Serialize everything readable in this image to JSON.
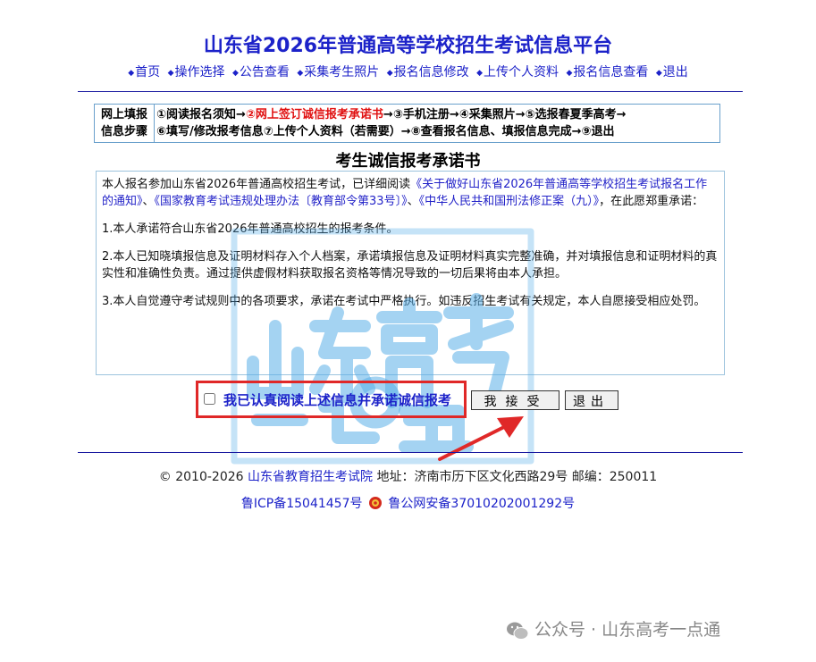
{
  "header": {
    "title": "山东省2026年普通高等学校招生考试信息平台",
    "nav": [
      "首页",
      "操作选择",
      "公告查看",
      "采集考生照片",
      "报名信息修改",
      "上传个人资料",
      "报名信息查看",
      "退出"
    ]
  },
  "steps": {
    "label_line1": "网上填报",
    "label_line2": "信息步骤",
    "line1_pre": "①阅读报名须知→",
    "line1_current": "②网上签订诚信报考承诺书",
    "line1_post": "→③手机注册→④采集照片→⑤选报春夏季高考→",
    "line2": "⑥填写/修改报考信息⑦上传个人资料（若需要）→⑧查看报名信息、填报信息完成→⑨退出"
  },
  "contract": {
    "heading": "考生诚信报考承诺书",
    "intro_pre": "本人报名参加山东省2026年普通高校招生考试，已详细阅读",
    "intro_link1": "《关于做好山东省2026年普通高等学校招生考试报名工作的通知》",
    "intro_sep1": "、",
    "intro_link2": "《国家教育考试违规处理办法〔教育部令第33号〕》",
    "intro_sep2": "、",
    "intro_link3": "《中华人民共和国刑法修正案（九）》",
    "intro_post": "，在此愿郑重承诺：",
    "items": [
      "1.本人承诺符合山东省2026年普通高校招生的报考条件。",
      "2.本人已知晓填报信息及证明材料存入个人档案，承诺填报信息及证明材料真实完整准确，并对填报信息和证明材料的真实性和准确性负责。通过提供虚假材料获取报名资格等情况导致的一切后果将由本人承担。",
      "3.本人自觉遵守考试规则中的各项要求，承诺在考试中严格执行。如违反招生考试有关规定，本人自愿接受相应处罚。"
    ]
  },
  "agreement": {
    "checkbox_label": "我已认真阅读上述信息并承诺诚信报考",
    "accept_button": "我接受",
    "exit_button": "退出"
  },
  "footer": {
    "copyright": "© 2010-2026",
    "org": "山东省教育招生考试院",
    "address": "地址：济南市历下区文化西路29号 邮编：250011",
    "icp": "鲁ICP备15041457号",
    "police": "鲁公网安备37010202001292号"
  },
  "overlay": {
    "watermark": "山东高考一点通",
    "wechat_prefix": "公众号 · ",
    "wechat_name": "山东高考一点通"
  },
  "colors": {
    "link_blue": "#1c22c9",
    "highlight_red": "#e02828",
    "current_step_red": "#e01010"
  }
}
